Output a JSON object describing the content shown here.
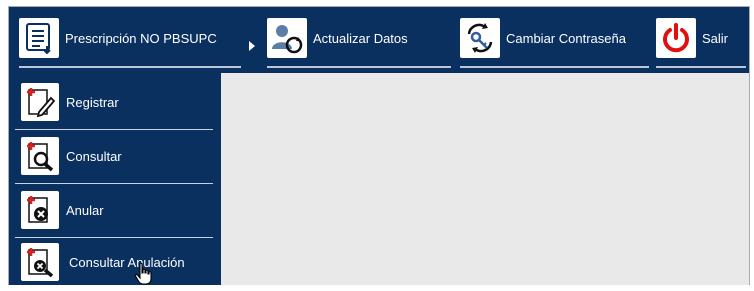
{
  "menu": {
    "prescripcion_label": "Prescripción NO PBSUPC",
    "actualizar_label": "Actualizar Datos",
    "cambiar_label": "Cambiar Contraseña",
    "salir_label": "Salir",
    "icons": {
      "prescripcion": "document-list-icon",
      "actualizar": "user-refresh-icon",
      "cambiar": "key-refresh-icon",
      "salir": "power-icon"
    }
  },
  "submenu": {
    "items": [
      {
        "label": "Registrar",
        "icon": "document-edit-icon"
      },
      {
        "label": "Consultar",
        "icon": "document-search-icon"
      },
      {
        "label": "Anular",
        "icon": "document-cancel-icon"
      },
      {
        "label": "Consultar Anulación",
        "icon": "document-cancel-search-icon"
      }
    ]
  },
  "colors": {
    "menu_bg": "#0a3060",
    "content_bg": "#e9e9e9",
    "power_red": "#e01010",
    "plus_red": "#e02020"
  }
}
